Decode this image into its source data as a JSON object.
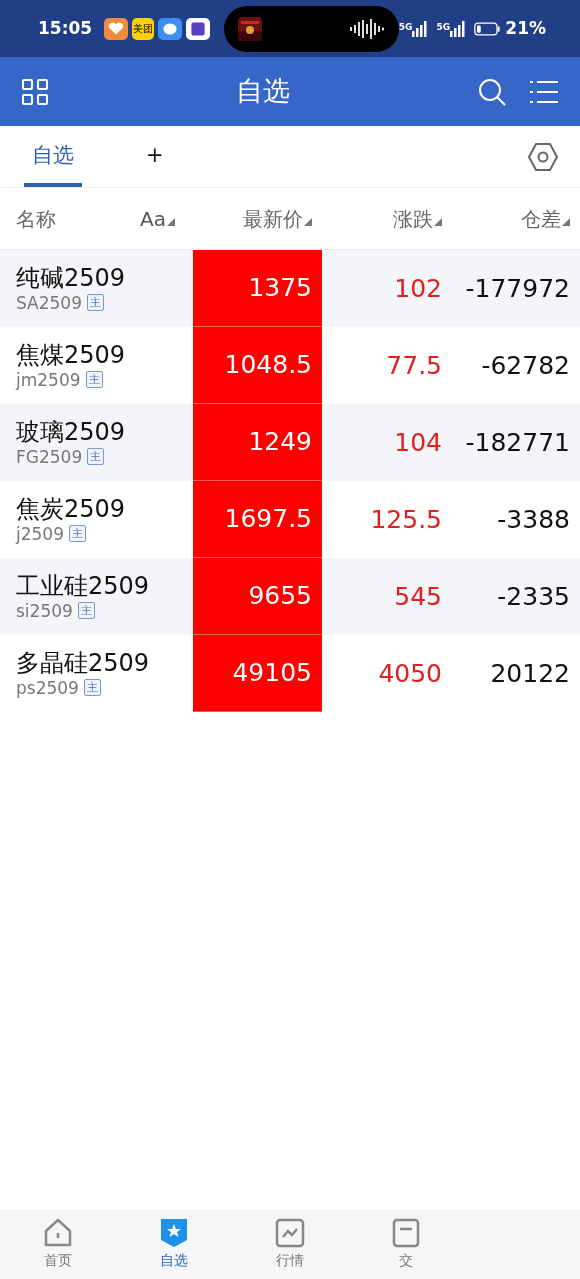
{
  "status_bar": {
    "time": "15:05",
    "app_icons": [
      {
        "label": "美团",
        "color": "#ffd100"
      }
    ],
    "network": [
      "5G",
      "5G"
    ],
    "battery": {
      "level": 0.21,
      "text": "21%"
    }
  },
  "header": {
    "title": "自选"
  },
  "tabs": [
    {
      "label": "自选",
      "selected": true
    },
    {
      "label": "+",
      "selected": false
    }
  ],
  "columns": [
    {
      "label": "名称",
      "sortable": false
    },
    {
      "label": "Aa",
      "sortable": true
    },
    {
      "label": "最新价",
      "sortable": true
    },
    {
      "label": "涨跌",
      "sortable": true
    },
    {
      "label": "仓差",
      "sortable": true
    }
  ],
  "rows": [
    {
      "name": "纯碱2509",
      "code": "SA2509",
      "tag": "主",
      "price": "1375",
      "change": "102",
      "oi_change": "-177972"
    },
    {
      "name": "焦煤2509",
      "code": "jm2509",
      "tag": "主",
      "price": "1048.5",
      "change": "77.5",
      "oi_change": "-62782"
    },
    {
      "name": "玻璃2509",
      "code": "FG2509",
      "tag": "主",
      "price": "1249",
      "change": "104",
      "oi_change": "-182771"
    },
    {
      "name": "焦炭2509",
      "code": "j2509",
      "tag": "主",
      "price": "1697.5",
      "change": "125.5",
      "oi_change": "-3388"
    },
    {
      "name": "工业硅2509",
      "code": "si2509",
      "tag": "主",
      "price": "9655",
      "change": "545",
      "oi_change": "-2335"
    },
    {
      "name": "多晶硅2509",
      "code": "ps2509",
      "tag": "主",
      "price": "49105",
      "change": "4050",
      "oi_change": "20122"
    }
  ],
  "bottom_nav": [
    {
      "label": "首页",
      "kind": "home",
      "selected": false
    },
    {
      "label": "自选",
      "kind": "watch",
      "selected": true
    },
    {
      "label": "行情",
      "kind": "chart",
      "selected": false
    },
    {
      "label": "交",
      "kind": "trade",
      "selected": false
    }
  ]
}
